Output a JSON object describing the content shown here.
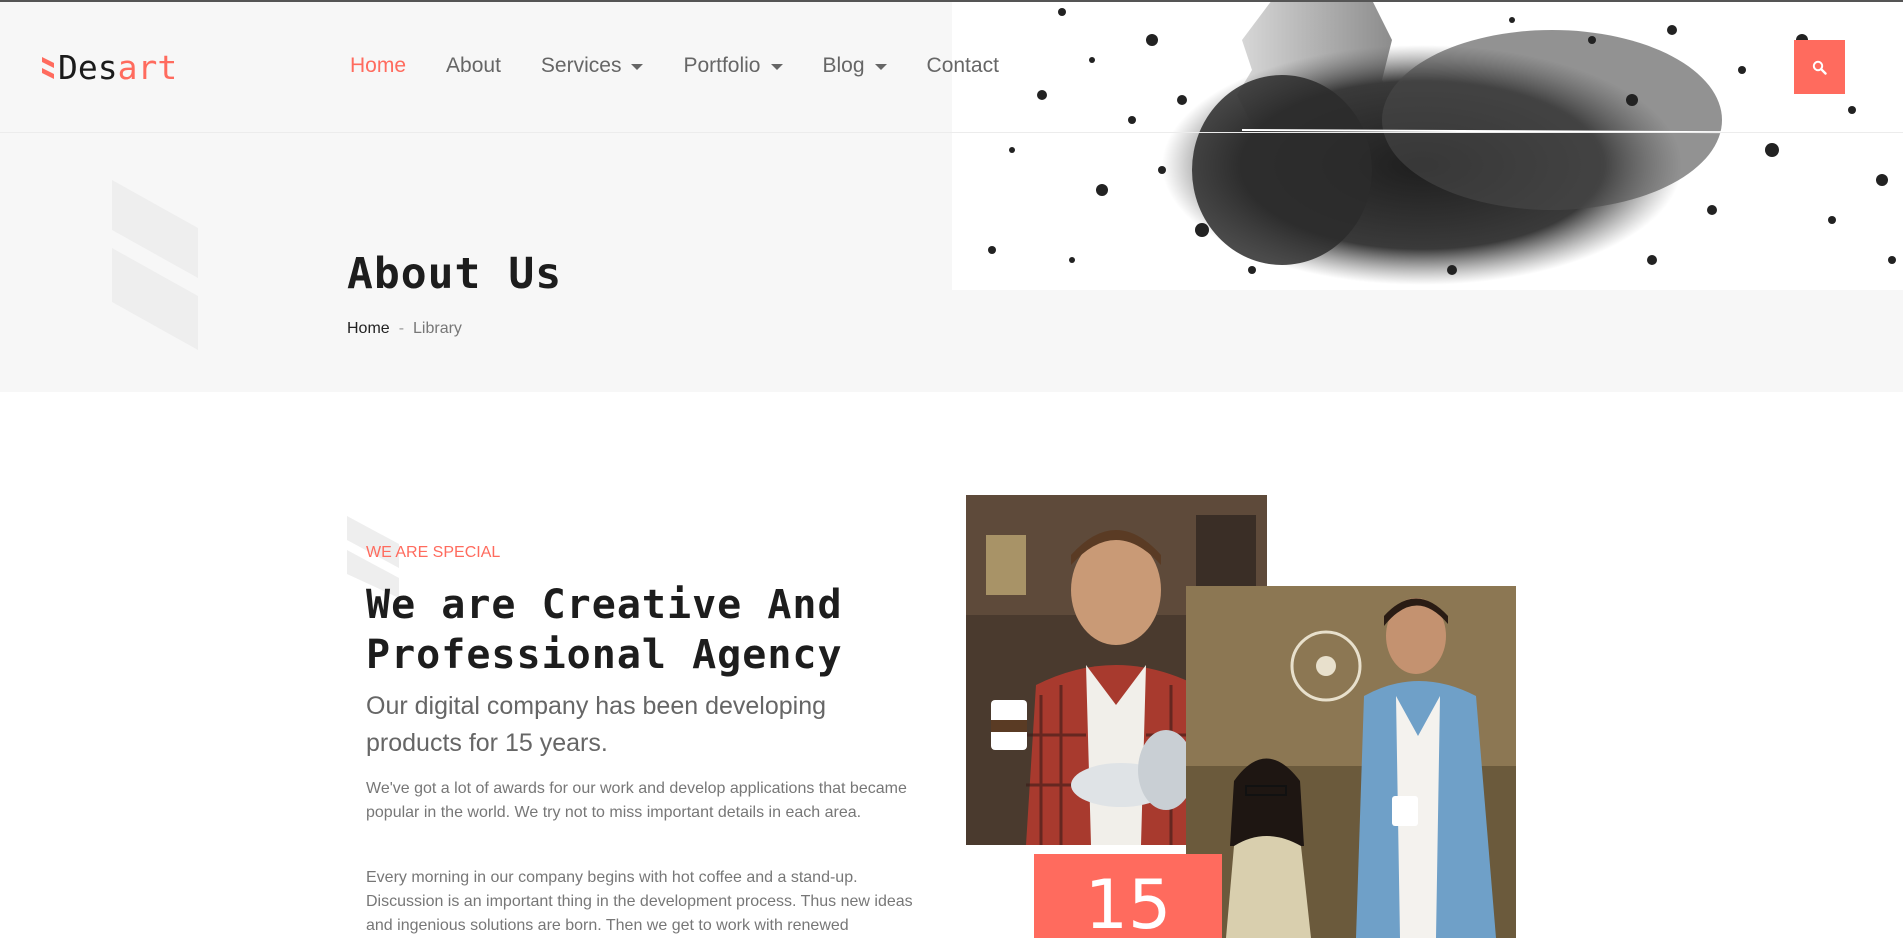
{
  "brand": {
    "logo_prefix": "Des",
    "logo_accent": "art",
    "accent_color": "#ff6b5e"
  },
  "nav": {
    "items": [
      {
        "label": "Home",
        "active": true,
        "has_dropdown": false
      },
      {
        "label": "About",
        "active": false,
        "has_dropdown": false
      },
      {
        "label": "Services",
        "active": false,
        "has_dropdown": true
      },
      {
        "label": "Portfolio",
        "active": false,
        "has_dropdown": true
      },
      {
        "label": "Blog",
        "active": false,
        "has_dropdown": true
      },
      {
        "label": "Contact",
        "active": false,
        "has_dropdown": false
      }
    ],
    "search_icon": "search-icon"
  },
  "page_header": {
    "title": "About Us",
    "breadcrumb": {
      "home": "Home",
      "separator": "-",
      "current": "Library"
    }
  },
  "about": {
    "eyebrow": "WE ARE SPECIAL",
    "headline": "We are Creative And Professional Agency",
    "lead": "Our digital company has been developing products for 15 years.",
    "paragraphs": [
      "We've got a lot of awards for our work and develop applications that became popular in the world. We try not to miss important details in each area.",
      "Every morning in our company begins with hot coffee and a stand-up. Discussion is an important thing in the development process. Thus new ideas and ingenious solutions are born. Then we get to work with renewed"
    ],
    "years_badge": "15"
  }
}
